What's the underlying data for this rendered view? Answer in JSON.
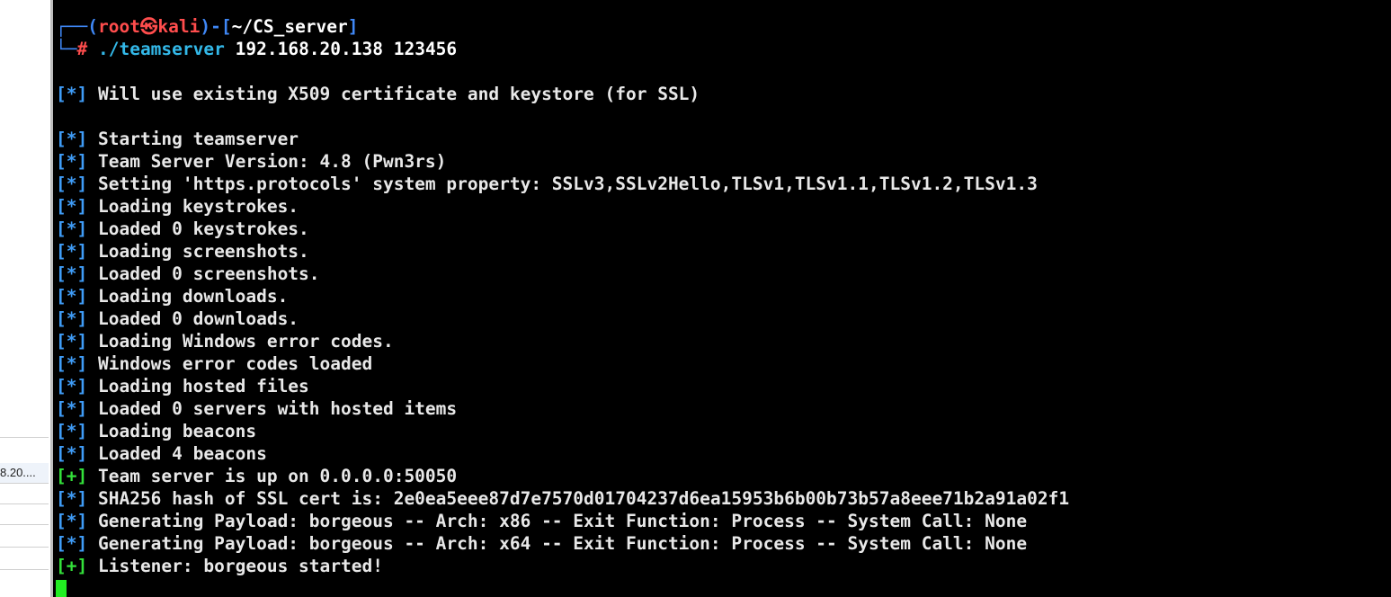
{
  "side_panel": {
    "visible_text": "8.20...."
  },
  "prompt": {
    "box_top": "┌──(",
    "user": "root㉿kali",
    "mid": ")-[",
    "cwd": "~/CS_server",
    "end": "]",
    "box_bottom": "└─",
    "hash": "#",
    "command": "./teamserver",
    "args": "192.168.20.138 123456"
  },
  "output": [
    {
      "tag": "[*]",
      "kind": "info",
      "text": "Will use existing X509 certificate and keystore (for SSL)"
    },
    {
      "blank": true
    },
    {
      "tag": "[*]",
      "kind": "info",
      "text": "Starting teamserver"
    },
    {
      "tag": "[*]",
      "kind": "info",
      "text": "Team Server Version: 4.8 (Pwn3rs)"
    },
    {
      "tag": "[*]",
      "kind": "info",
      "text": "Setting 'https.protocols' system property: SSLv3,SSLv2Hello,TLSv1,TLSv1.1,TLSv1.2,TLSv1.3"
    },
    {
      "tag": "[*]",
      "kind": "info",
      "text": "Loading keystrokes."
    },
    {
      "tag": "[*]",
      "kind": "info",
      "text": "Loaded 0 keystrokes."
    },
    {
      "tag": "[*]",
      "kind": "info",
      "text": "Loading screenshots."
    },
    {
      "tag": "[*]",
      "kind": "info",
      "text": "Loaded 0 screenshots."
    },
    {
      "tag": "[*]",
      "kind": "info",
      "text": "Loading downloads."
    },
    {
      "tag": "[*]",
      "kind": "info",
      "text": "Loaded 0 downloads."
    },
    {
      "tag": "[*]",
      "kind": "info",
      "text": "Loading Windows error codes."
    },
    {
      "tag": "[*]",
      "kind": "info",
      "text": "Windows error codes loaded"
    },
    {
      "tag": "[*]",
      "kind": "info",
      "text": "Loading hosted files"
    },
    {
      "tag": "[*]",
      "kind": "info",
      "text": "Loaded 0 servers with hosted items"
    },
    {
      "tag": "[*]",
      "kind": "info",
      "text": "Loading beacons"
    },
    {
      "tag": "[*]",
      "kind": "info",
      "text": "Loaded 4 beacons"
    },
    {
      "tag": "[+]",
      "kind": "ok",
      "text": "Team server is up on 0.0.0.0:50050"
    },
    {
      "tag": "[*]",
      "kind": "info",
      "text": "SHA256 hash of SSL cert is: 2e0ea5eee87d7e7570d01704237d6ea15953b6b00b73b57a8eee71b2a91a02f1"
    },
    {
      "tag": "[*]",
      "kind": "info",
      "text": "Generating Payload: borgeous -- Arch: x86 -- Exit Function: Process -- System Call: None"
    },
    {
      "tag": "[*]",
      "kind": "info",
      "text": "Generating Payload: borgeous -- Arch: x64 -- Exit Function: Process -- System Call: None"
    },
    {
      "tag": "[+]",
      "kind": "ok",
      "text": "Listener: borgeous started!"
    }
  ],
  "colors": {
    "background": "#000000",
    "info_tag": "#3f9cf7",
    "ok_tag": "#33e03a",
    "prompt_user": "#ff4d4d",
    "cursor": "#22ee22"
  }
}
